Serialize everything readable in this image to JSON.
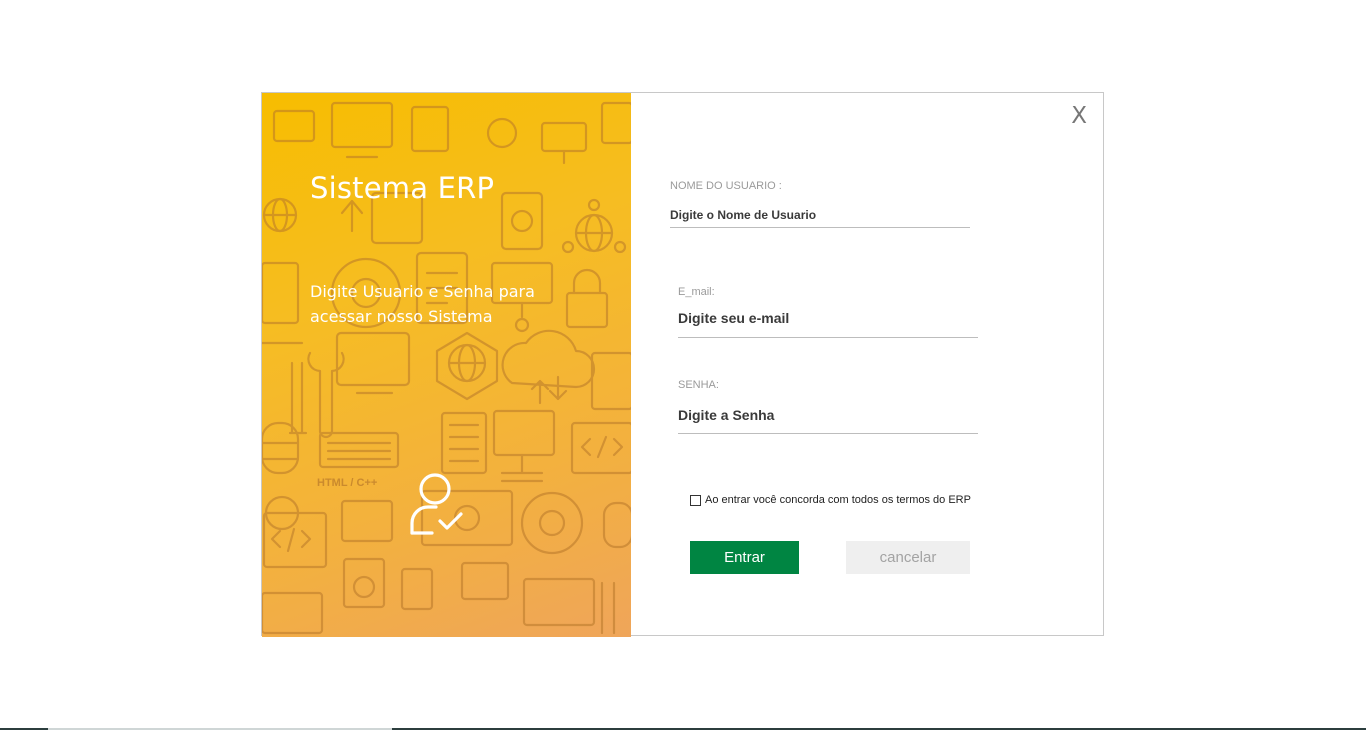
{
  "left_panel": {
    "title": "Sistema ERP",
    "subtitle": "Digite Usuario e Senha para acessar nosso Sistema",
    "pattern_text": "HTML / C++",
    "icon": "user-check-icon",
    "gradient_colors": [
      "#f7bd00",
      "#efa55a"
    ]
  },
  "close": {
    "label": "X"
  },
  "form": {
    "username": {
      "label": "NOME DO USUARIO :",
      "placeholder": "Digite o Nome de Usuario",
      "value": ""
    },
    "email": {
      "label": "E_mail:",
      "placeholder": "Digite seu e-mail",
      "value": ""
    },
    "password": {
      "label": "SENHA:",
      "placeholder": "Digite a Senha",
      "value": ""
    },
    "terms_label": "Ao entrar você concorda com todos os termos do ERP",
    "terms_checked": false,
    "submit_label": "Entrar",
    "cancel_label": "cancelar"
  },
  "colors": {
    "primary_button": "#008542",
    "cancel_button": "#efefef",
    "panel_accent": "#f7bd00"
  }
}
